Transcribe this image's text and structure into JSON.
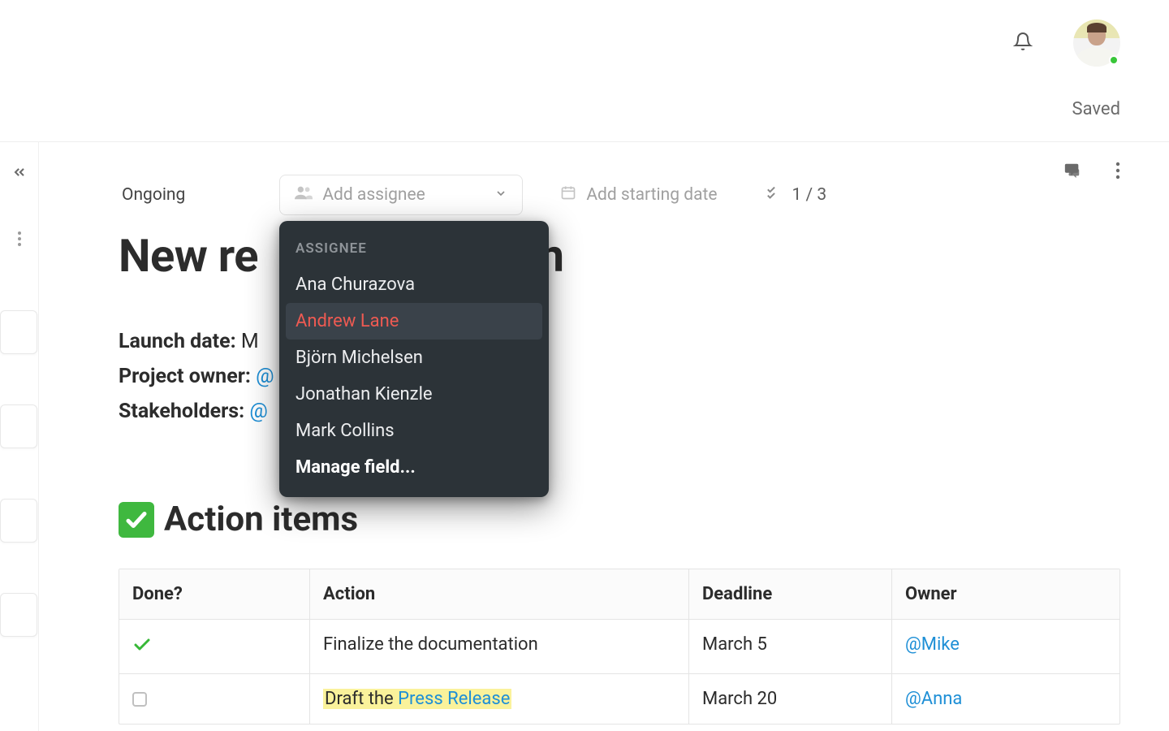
{
  "header": {
    "saved_label": "Saved"
  },
  "meta": {
    "status": "Ongoing",
    "assignee_placeholder": "Add assignee",
    "date_placeholder": "Add starting date",
    "check_count": "1 / 3"
  },
  "title": "New re                     tion",
  "details": {
    "launch_date_label": "Launch date:",
    "launch_date_value": "M",
    "project_owner_label": "Project owner:",
    "project_owner_mention_prefix": "@",
    "stakeholders_label": "Stakeholders:",
    "stakeholders_mention_prefix": "@"
  },
  "section": {
    "heading": "Action items"
  },
  "table": {
    "headers": {
      "done": "Done?",
      "action": "Action",
      "deadline": "Deadline",
      "owner": "Owner"
    },
    "rows": [
      {
        "done": true,
        "action_plain": "Finalize the documentation",
        "deadline": "March 5",
        "owner": "@Mike"
      },
      {
        "done": false,
        "action_highlight_prefix": "Draft the ",
        "action_highlight_link": "Press Release",
        "deadline": "March 20",
        "owner": "@Anna"
      }
    ]
  },
  "dropdown": {
    "header": "ASSIGNEE",
    "items": [
      {
        "label": "Ana Churazova",
        "selected": false
      },
      {
        "label": "Andrew Lane",
        "selected": true
      },
      {
        "label": "Björn Michelsen",
        "selected": false
      },
      {
        "label": "Jonathan Kienzle",
        "selected": false
      },
      {
        "label": "Mark Collins",
        "selected": false
      }
    ],
    "manage_label": "Manage field..."
  }
}
